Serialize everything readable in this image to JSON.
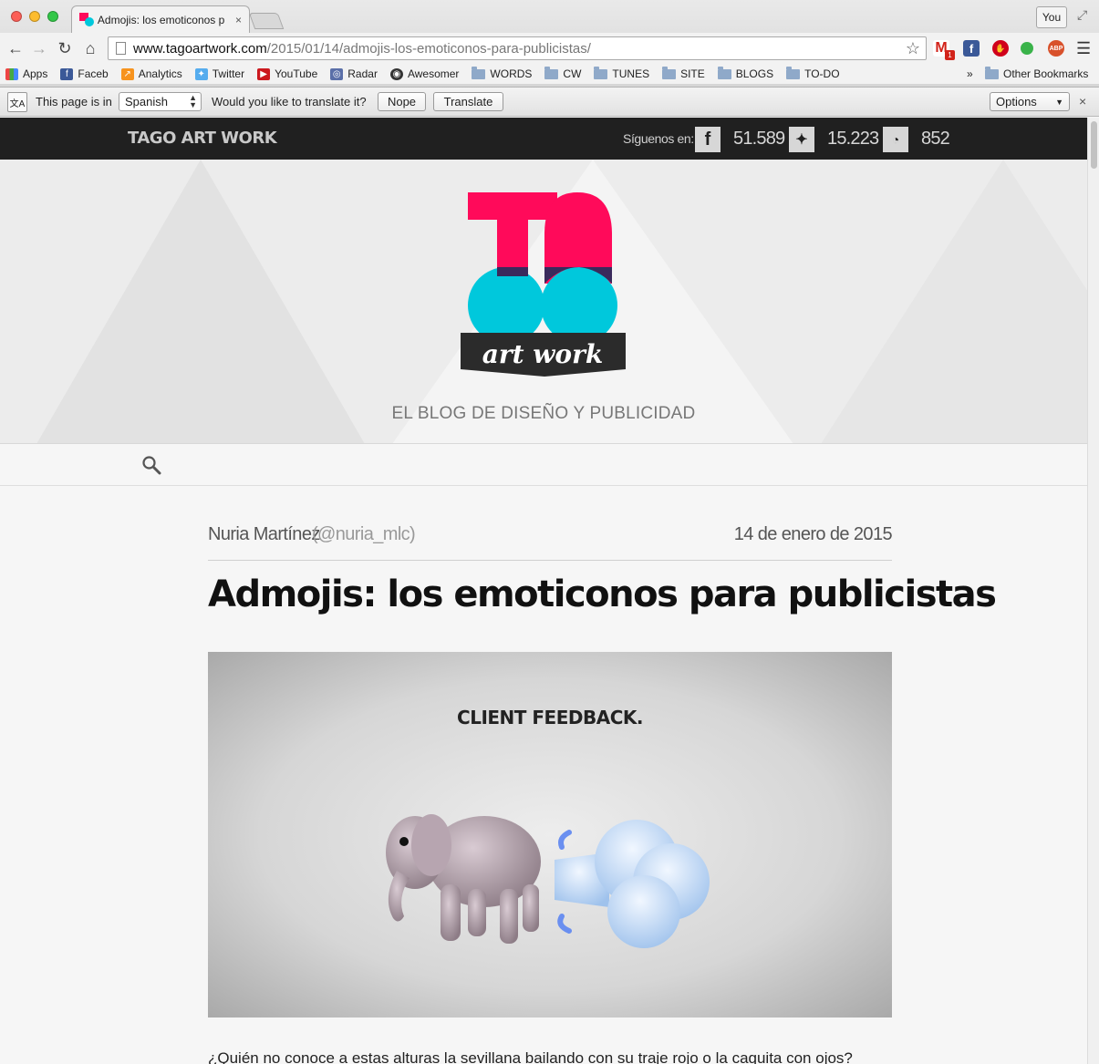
{
  "browser": {
    "tab_title": "Admojis: los emoticonos p",
    "tab_close": "×",
    "profile": "You",
    "url_host": "www.tagoartwork.com",
    "url_path": "/2015/01/14/admojis-los-emoticonos-para-publicistas/",
    "gmail_badge": "1",
    "abp": "ABP"
  },
  "bookmarks": {
    "items": [
      {
        "label": "Apps",
        "icon": "apps-grid-icon"
      },
      {
        "label": "Faceb",
        "icon": "facebook-icon"
      },
      {
        "label": "Analytics",
        "icon": "analytics-icon"
      },
      {
        "label": "Twitter",
        "icon": "twitter-bird-icon"
      },
      {
        "label": "YouTube",
        "icon": "youtube-icon"
      },
      {
        "label": "Radar",
        "icon": "radar-icon"
      },
      {
        "label": "Awesomer",
        "icon": "awesomer-icon"
      }
    ],
    "folders": [
      "WORDS",
      "CW",
      "TUNES",
      "SITE",
      "BLOGS",
      "TO-DO"
    ],
    "chevron": "»",
    "other": "Other Bookmarks"
  },
  "translate_bar": {
    "page_is_in": "This page is in",
    "language": "Spanish",
    "question": "Would you like to translate it?",
    "nope": "Nope",
    "translate": "Translate",
    "options": "Options",
    "close": "×"
  },
  "site": {
    "name": "TAGO ART WORK",
    "follow_label": "Síguenos en:",
    "facebook_count": "51.589",
    "twitter_count": "15.223",
    "rss_count": "852",
    "logo_text": "art work",
    "tagline": "EL BLOG DE DISEÑO Y PUBLICIDAD"
  },
  "article": {
    "author": "Nuria Martínez",
    "handle": "(@nuria_mlc)",
    "date": "14 de enero de 2015",
    "title": "Admojis: los emoticonos para publicistas",
    "image_caption": "CLIENT FEEDBACK.",
    "paragraph": "¿Quién no conoce a estas alturas la sevillana bailando con su traje rojo o la caquita con ojos?"
  },
  "colors": {
    "logo_pink": "#ff0a5a",
    "logo_cyan": "#00c8dc",
    "logo_purple": "#3a2a5c",
    "dark_bar": "#202020"
  }
}
